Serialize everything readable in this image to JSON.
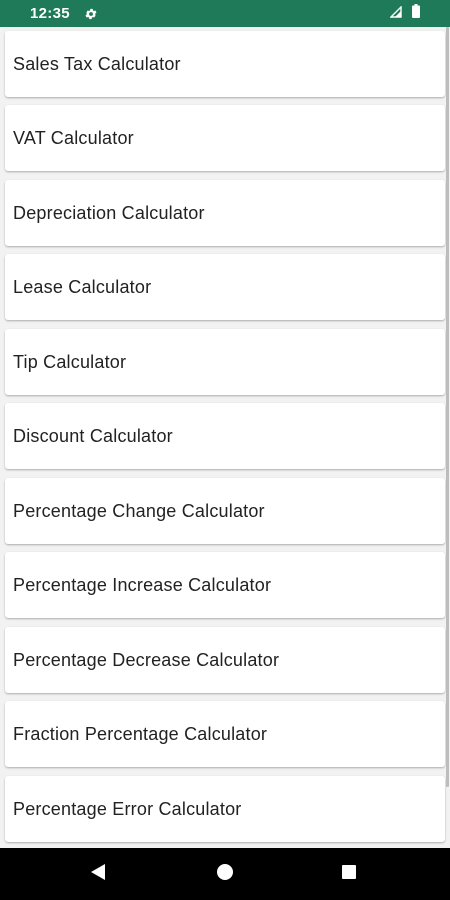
{
  "status_bar": {
    "time": "12:35",
    "background": "#1f7a5a",
    "icons": [
      "settings-gear-icon",
      "signal-icon",
      "battery-icon"
    ]
  },
  "calculators": [
    {
      "label": "Sales Tax Calculator"
    },
    {
      "label": "VAT Calculator"
    },
    {
      "label": "Depreciation Calculator"
    },
    {
      "label": "Lease Calculator"
    },
    {
      "label": "Tip Calculator"
    },
    {
      "label": "Discount Calculator"
    },
    {
      "label": "Percentage Change Calculator"
    },
    {
      "label": "Percentage Increase Calculator"
    },
    {
      "label": "Percentage Decrease Calculator"
    },
    {
      "label": "Fraction Percentage Calculator"
    },
    {
      "label": "Percentage Error Calculator"
    }
  ],
  "nav_bar": {
    "background": "#000000",
    "icons": [
      "back-triangle-icon",
      "home-circle-icon",
      "recents-square-icon"
    ]
  }
}
